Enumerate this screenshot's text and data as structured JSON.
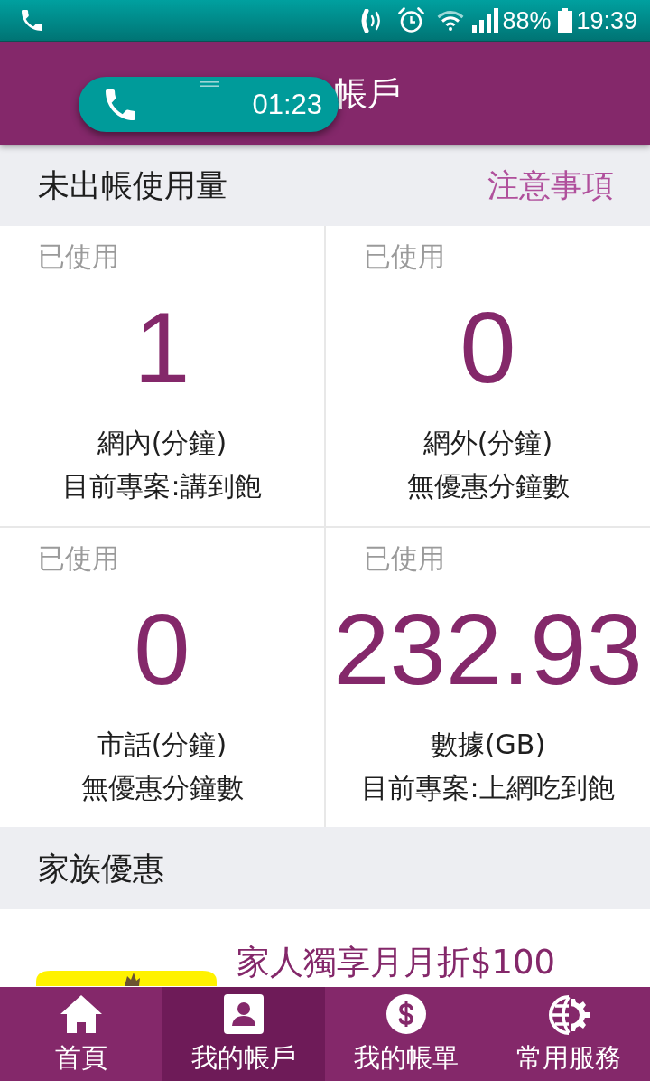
{
  "status_bar": {
    "battery": "88%",
    "time": "19:39"
  },
  "app_bar": {
    "title": "帳戶"
  },
  "call_bubble": {
    "timer": "01:23"
  },
  "usage_section": {
    "title": "未出帳使用量",
    "link": "注意事項"
  },
  "usage_cards": [
    {
      "caption": "已使用",
      "value": "1",
      "label": "網內(分鐘)",
      "plan": "目前專案:講到飽"
    },
    {
      "caption": "已使用",
      "value": "0",
      "label": "網外(分鐘)",
      "plan": "無優惠分鐘數"
    },
    {
      "caption": "已使用",
      "value": "0",
      "label": "市話(分鐘)",
      "plan": "無優惠分鐘數"
    },
    {
      "caption": "已使用",
      "value": "232.93",
      "label": "數據(GB)",
      "plan": "目前專案:上網吃到飽"
    }
  ],
  "family_section": {
    "title": "家族優惠"
  },
  "promo": {
    "headline": "家人獨享月月折$100"
  },
  "bottom_nav": [
    {
      "kind": "home",
      "label": "首頁",
      "selected": false
    },
    {
      "kind": "account",
      "label": "我的帳戶",
      "selected": true
    },
    {
      "kind": "bill",
      "label": "我的帳單",
      "selected": false
    },
    {
      "kind": "services",
      "label": "常用服務",
      "selected": false
    }
  ]
}
